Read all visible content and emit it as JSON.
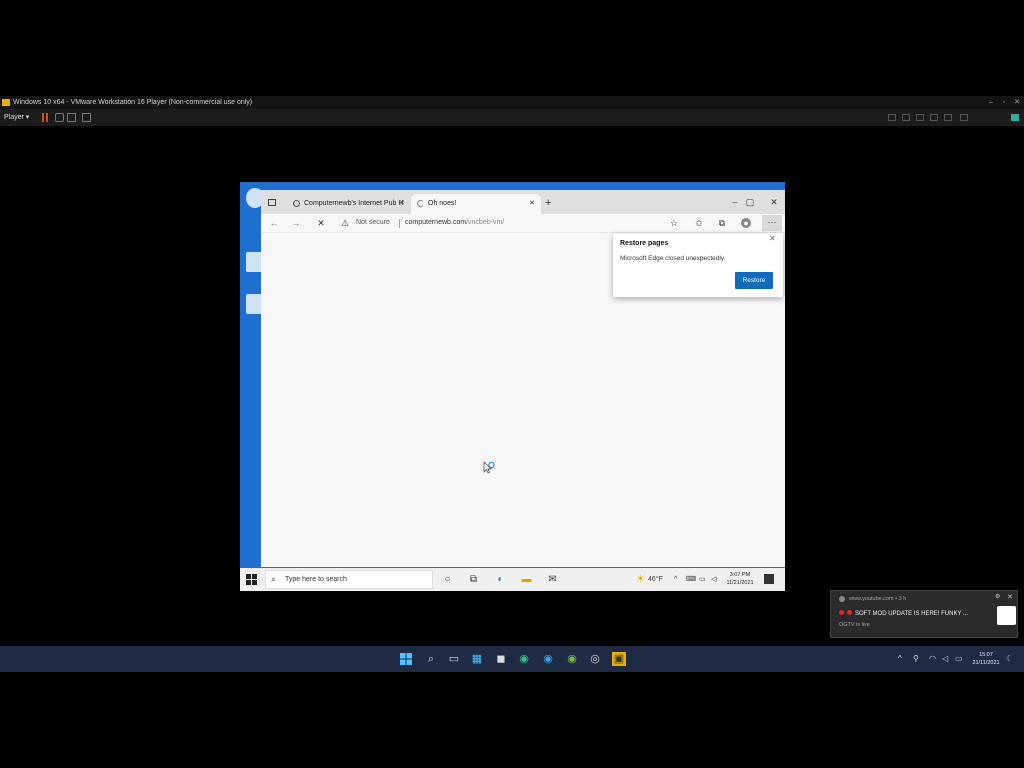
{
  "vmware": {
    "title": "Windows 10 x64 - VMware Workstation 16 Player (Non-commercial use only)",
    "player_menu": "Player ▾",
    "window_controls": [
      "–",
      "▫",
      "✕"
    ]
  },
  "guest": {
    "edge": {
      "tabs": [
        {
          "label": "Computernewb's Internet Pub H"
        },
        {
          "label": "Oh noes!"
        }
      ],
      "new_tab": "+",
      "window_controls": [
        "–",
        "▢",
        "✕"
      ],
      "address": {
        "security": "Not secure",
        "domain": "computernewb.com",
        "path": "/vncbeb-vm/"
      },
      "restore_popup": {
        "title": "Restore pages",
        "message": "Microsoft Edge closed unexpectedly.",
        "button": "Restore",
        "close": "✕"
      }
    },
    "taskbar": {
      "search_placeholder": "Type here to search",
      "weather": "46°F",
      "time": "3:07 PM",
      "date": "11/21/2021"
    }
  },
  "host": {
    "toast": {
      "source": "www.youtube.com • 3 h",
      "title": "SOFT MOD UPDATE IS HERE! FUNKY ...",
      "body": "OGTV is live"
    },
    "taskbar": {
      "time": "15:07",
      "date": "21/11/2021"
    }
  },
  "colors": {
    "accent_blue": "#0f6cbd",
    "host_taskbar": "#1f2a44",
    "vmware_pause": "#e24a1a"
  }
}
